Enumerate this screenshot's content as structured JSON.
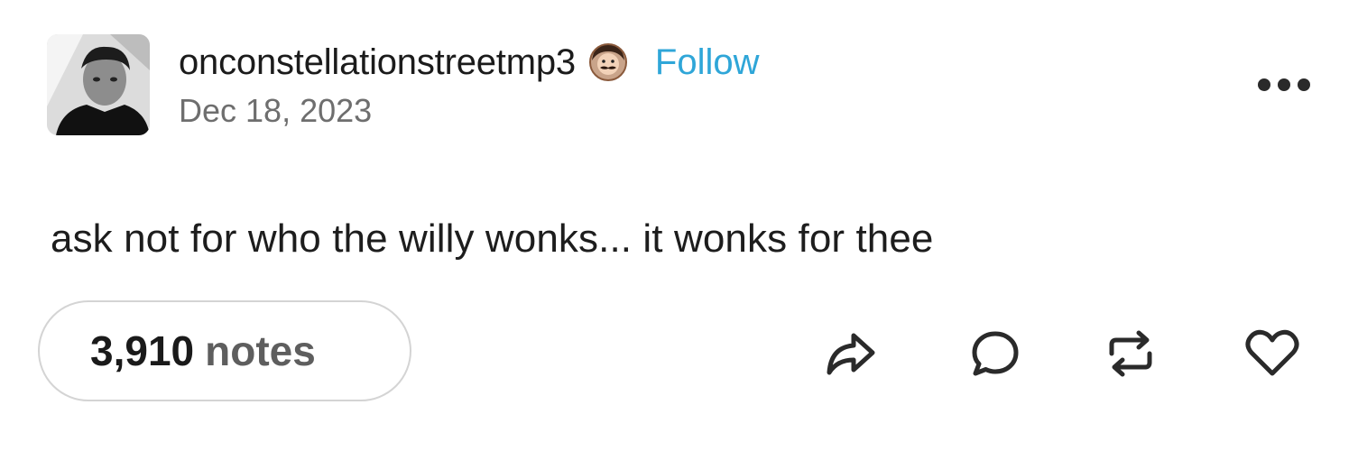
{
  "post": {
    "author": {
      "username": "onconstellationstreetmp3",
      "avatar_icon": "avatar-photo",
      "badge_icon": "mustache-face-badge-icon",
      "follow_label": "Follow",
      "follow_color": "#2fa6d8"
    },
    "date": "Dec 18, 2023",
    "text": "ask not for who the willy wonks... it wonks for thee",
    "notes": {
      "count": "3,910",
      "label": "notes"
    },
    "actions": [
      {
        "icon": "share-icon"
      },
      {
        "icon": "reply-icon"
      },
      {
        "icon": "reblog-icon"
      },
      {
        "icon": "like-icon"
      }
    ],
    "menu_icon": "more-options-icon"
  }
}
